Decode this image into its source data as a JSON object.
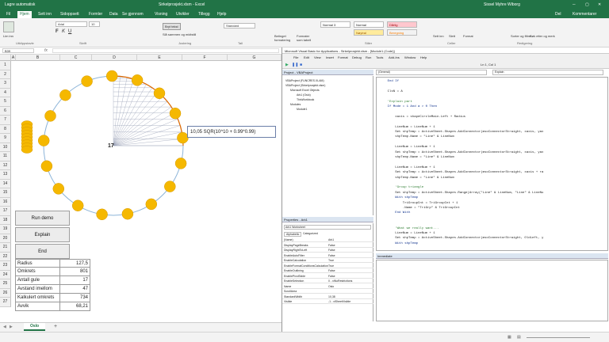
{
  "excel": {
    "title": "Sirkelprosjekt.xlsm - Excel",
    "save_label": "Lagre automatisk",
    "user": "Sissel Myhre Wiborg",
    "tabs": [
      "Fil",
      "Hjem",
      "Sett inn",
      "Sidoppsett",
      "Formler",
      "Data",
      "Se gjennom",
      "Visning",
      "Utvikler",
      "Tillegg",
      "Hjelp"
    ],
    "share_label": "Del",
    "comments_label": "Kommentarer",
    "ribbon": {
      "paste": "Lim inn",
      "font_name": "Arial",
      "font_size": "10",
      "wrap_text": "Bryt tekst",
      "merge": "Slå sammen og midtstill",
      "number_format": "Standard",
      "cond_format": "Betinget formatering",
      "format_table": "Formater som tabell",
      "styles": [
        "Normal 3",
        "Normal",
        "Dårlig",
        "Nøytral",
        "Beregning"
      ],
      "insert": "Sett inn",
      "delete": "Slett",
      "format": "Format",
      "sort": "Sorter og filtrer",
      "find": "Søk etter og merk",
      "group_labels": [
        "Utklippstavle",
        "Skrift",
        "Justering",
        "Tall",
        "Stiler",
        "Celler",
        "Redigering"
      ]
    },
    "name_box": "B39",
    "columns": [
      "A",
      "B",
      "C",
      "D",
      "E",
      "F",
      "G"
    ],
    "rows": [
      "1",
      "2",
      "3",
      "4",
      "5",
      "6",
      "7",
      "8",
      "9",
      "10",
      "11",
      "12",
      "13",
      "14",
      "15",
      "16",
      "17",
      "18",
      "19",
      "20",
      "21",
      "22",
      "23",
      "24",
      "25",
      "26",
      "27"
    ],
    "shape_label": "10,05 SQR(10^10 + 0.99*0.99)",
    "center_label": "17",
    "buttons": {
      "run": "Run demo",
      "explain": "Explain",
      "end": "End"
    },
    "stats": [
      {
        "label": "Radius",
        "value": "127,5"
      },
      {
        "label": "Omkrets",
        "value": "801"
      },
      {
        "label": "Antall gule",
        "value": "17"
      },
      {
        "label": "Avstand imellom",
        "value": "47"
      },
      {
        "label": "Kalkulert omkrets",
        "value": "734"
      },
      {
        "label": "Avvik",
        "value": "68,21"
      }
    ],
    "sheet_tab": "Oslo",
    "add_sheet": "+"
  },
  "vbe": {
    "title": "Microsoft Visual Basic for Applications - Sirkelprosjekt.xlsm - [Module1 (Code)]",
    "menu": [
      "File",
      "Edit",
      "View",
      "Insert",
      "Format",
      "Debug",
      "Run",
      "Tools",
      "Add-Ins",
      "Window",
      "Help"
    ],
    "cursor_pos": "Ln 1, Col 1",
    "project_title": "Project - VBAProject",
    "project_tree": [
      "VBAProject (FUNCRES.XLAM)",
      "VBAProject (Sirkelprosjekt.xlsm)",
      "Microsoft Excel Objects",
      "Ark1 (Oslo)",
      "ThisWorkbook",
      "Modules",
      "Module1"
    ],
    "properties_title": "Properties - Ark1",
    "properties_object": "Ark1 Worksheet",
    "properties_tabs": [
      "Alphabetic",
      "Categorized"
    ],
    "properties": [
      {
        "name": "(Name)",
        "value": "Ark1"
      },
      {
        "name": "DisplayPageBreaks",
        "value": "False"
      },
      {
        "name": "DisplayRightToLeft",
        "value": "False"
      },
      {
        "name": "EnableAutoFilter",
        "value": "False"
      },
      {
        "name": "EnableCalculation",
        "value": "True"
      },
      {
        "name": "EnableFormatConditionsCalculation",
        "value": "True"
      },
      {
        "name": "EnableOutlining",
        "value": "False"
      },
      {
        "name": "EnablePivotTable",
        "value": "False"
      },
      {
        "name": "EnableSelection",
        "value": "0 - xlNoRestrictions"
      },
      {
        "name": "Name",
        "value": "Oslo"
      },
      {
        "name": "ScrollArea",
        "value": ""
      },
      {
        "name": "StandardWidth",
        "value": "10,38"
      },
      {
        "name": "Visible",
        "value": "-1 - xlSheetVisible"
      }
    ],
    "proc_dropdown": "(General)",
    "event_dropdown": "Explain",
    "code": [
      {
        "t": "    End If",
        "k": "kw"
      },
      {
        "t": "",
        "k": ""
      },
      {
        "t": "    ClsN = A",
        "k": ""
      },
      {
        "t": "",
        "k": ""
      },
      {
        "t": "    'Explain part",
        "k": "cm"
      },
      {
        "t": "    If Mode = 1 And a > 0 Then",
        "k": "kw"
      },
      {
        "t": "",
        "k": ""
      },
      {
        "t": "        xaxis = shapeCircleMain.Left + Radius",
        "k": ""
      },
      {
        "t": "",
        "k": ""
      },
      {
        "t": "        LineNum = LineNum + 1",
        "k": ""
      },
      {
        "t": "        Set shpTemp = ActiveSheet.Shapes.AddConnector(msoConnectorStraight, xaxis, yax",
        "k": ""
      },
      {
        "t": "        shpTemp.Name = \"Line\" & LineNum",
        "k": ""
      },
      {
        "t": "",
        "k": ""
      },
      {
        "t": "        LineNum = LineNum + 1",
        "k": ""
      },
      {
        "t": "        Set shpTemp = ActiveSheet.Shapes.AddConnector(msoConnectorStraight, xaxis, yax",
        "k": ""
      },
      {
        "t": "        shpTemp.Name = \"Line\" & LineNum",
        "k": ""
      },
      {
        "t": "",
        "k": ""
      },
      {
        "t": "        LineNum = LineNum + 1",
        "k": ""
      },
      {
        "t": "        Set shpTemp = ActiveSheet.Shapes.AddConnector(msoConnectorStraight, xaxis + ra",
        "k": ""
      },
      {
        "t": "        shpTemp.Name = \"Line\" & LineNum",
        "k": ""
      },
      {
        "t": "",
        "k": ""
      },
      {
        "t": "        'Group triangle",
        "k": "cm"
      },
      {
        "t": "        Set shpTemp = ActiveSheet.Shapes.Range(Array(\"Line\" & LineNum, \"Line\" & LineNu",
        "k": ""
      },
      {
        "t": "        With shpTemp",
        "k": "kw"
      },
      {
        "t": "            TriGroupCnt = TriGroupCnt + 1",
        "k": ""
      },
      {
        "t": "            .Name = \"TriGrp\" & TriGroupCnt",
        "k": ""
      },
      {
        "t": "        End With",
        "k": "kw"
      },
      {
        "t": "",
        "k": ""
      },
      {
        "t": "",
        "k": ""
      },
      {
        "t": "        'What we really want...",
        "k": "cm"
      },
      {
        "t": "        LineNum = LineNum + 1",
        "k": ""
      },
      {
        "t": "        Set shpTemp = ActiveSheet.Shapes.AddConnector(msoConnectorStraight, OldLeft, y",
        "k": ""
      },
      {
        "t": "        With shpTemp",
        "k": "kw"
      }
    ],
    "immediate_title": "Immediate"
  },
  "colors": {
    "excel_green": "#217346",
    "circle_yellow": "#f5b800",
    "circle_orange": "#e06a00",
    "circle_line": "#8cb4d8"
  }
}
